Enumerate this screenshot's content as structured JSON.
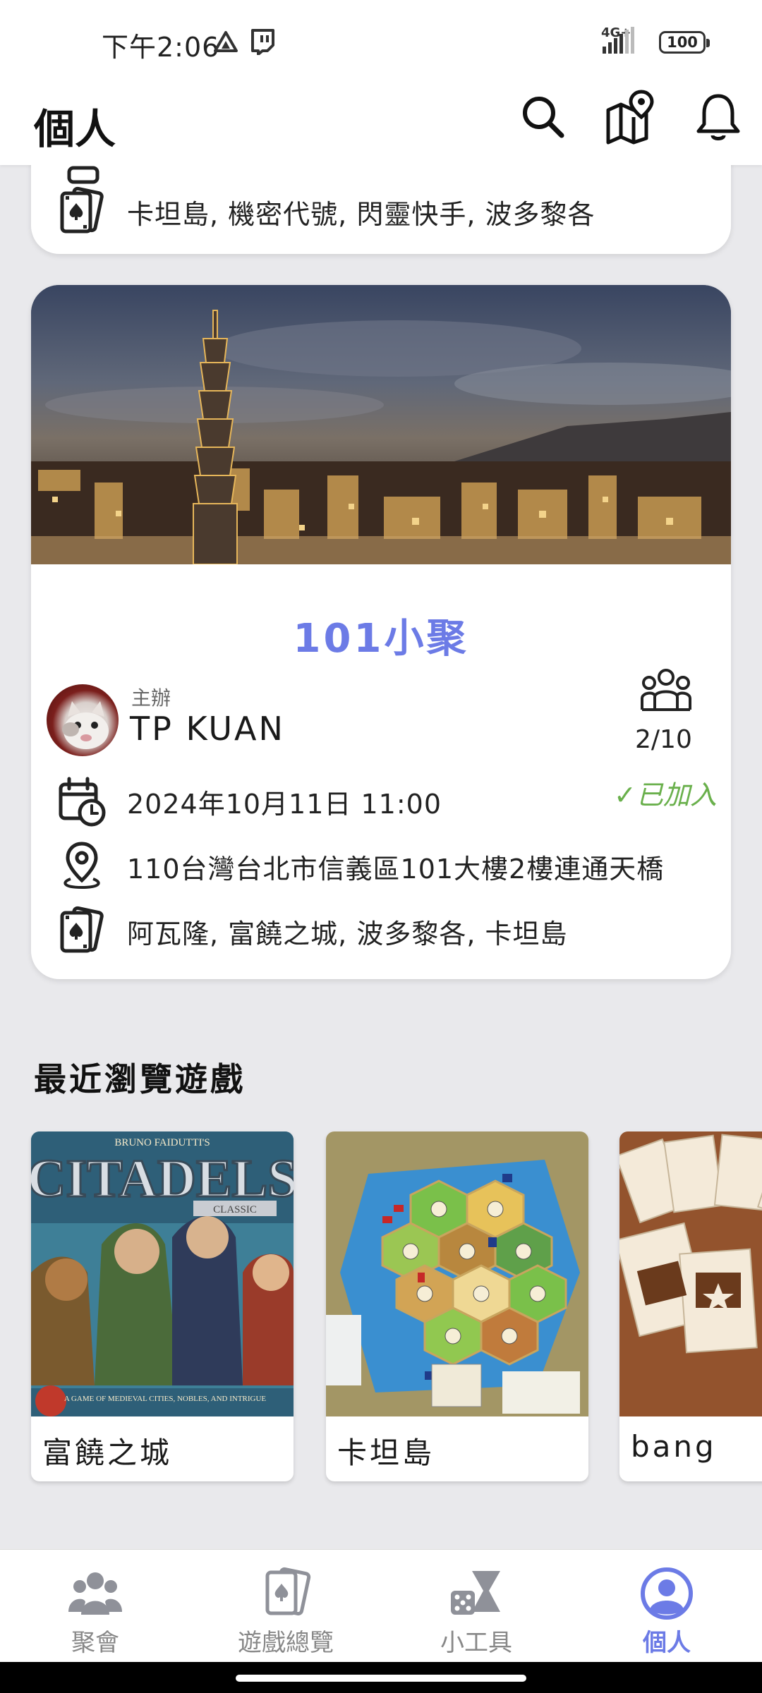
{
  "status_bar": {
    "time": "下午2:06",
    "network": "4G+",
    "battery": "100"
  },
  "app_bar": {
    "title": "個人",
    "icons": [
      "search-icon",
      "map-pin-icon",
      "bell-icon"
    ]
  },
  "prev_event": {
    "games": "卡坦島, 機密代號, 閃靈快手, 波多黎各"
  },
  "event": {
    "title": "101小聚",
    "host_label": "主辦",
    "host_name": "TP KUAN",
    "members": "2/10",
    "joined": "✓已加入",
    "datetime": "2024年10月11日 11:00",
    "location": "110台灣台北市信義區101大樓2樓連通天橋",
    "games": "阿瓦隆, 富饒之城, 波多黎各, 卡坦島"
  },
  "recent_section": {
    "title": "最近瀏覽遊戲",
    "games": [
      {
        "name": "富饒之城"
      },
      {
        "name": "卡坦島"
      },
      {
        "name": "bang"
      }
    ]
  },
  "cover_text": {
    "citadels_author": "BRUNO FAIDUTTI'S",
    "citadels_title": "CITADELS",
    "citadels_edition": "CLASSIC",
    "citadels_tagline": "A GAME OF MEDIEVAL CITIES, NOBLES, AND INTRIGUE"
  },
  "bottom_nav": {
    "items": [
      {
        "label": "聚會",
        "icon": "group-icon"
      },
      {
        "label": "遊戲總覽",
        "icon": "cards-icon"
      },
      {
        "label": "小工具",
        "icon": "dice-hourglass-icon"
      },
      {
        "label": "個人",
        "icon": "profile-icon"
      }
    ],
    "active_index": 3
  },
  "colors": {
    "accent": "#6c7be6",
    "joined": "#6ab04c",
    "background": "#e9e9ec"
  }
}
